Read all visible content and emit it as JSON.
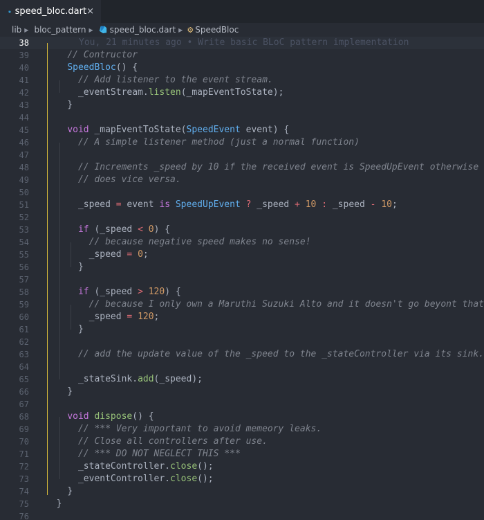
{
  "tab": {
    "label": "speed_bloc.dart",
    "close": "×"
  },
  "breadcrumb": [
    "lib",
    "bloc_pattern",
    "speed_bloc.dart",
    "SpeedBloc"
  ],
  "colors": {
    "accent": "#d7ba3a",
    "editor_bg": "#282c34",
    "tab_bg": "#21252b"
  },
  "icons": {
    "tab": "dart-file-icon",
    "breadcrumb_file": "dart-file-icon",
    "breadcrumb_class": "class-icon"
  },
  "current_line": 38,
  "blame": "You, 21 minutes ago • Write basic BLoC pattern implementation",
  "lines": [
    {
      "num": 38,
      "html": ""
    },
    {
      "num": 39,
      "html": "    <span class=\"c\">// Contructor</span>"
    },
    {
      "num": 40,
      "html": "    <span class=\"t\">SpeedBloc</span>() {"
    },
    {
      "num": 41,
      "html": "      <span class=\"c\">// Add listener to the event stream.</span>"
    },
    {
      "num": 42,
      "html": "      _eventStream.<span class=\"f\">listen</span>(_mapEventToState);"
    },
    {
      "num": 43,
      "html": "    }"
    },
    {
      "num": 44,
      "html": ""
    },
    {
      "num": 45,
      "html": "    <span class=\"k\">void</span> _mapEventToState(<span class=\"t\">SpeedEvent</span> event) {"
    },
    {
      "num": 46,
      "html": "      <span class=\"c\">// A simple listener method (just a normal function)</span>"
    },
    {
      "num": 47,
      "html": ""
    },
    {
      "num": 48,
      "html": "      <span class=\"c\">// Increments _speed by 10 if the received event is SpeedUpEvent otherwise</span>"
    },
    {
      "num": 49,
      "html": "      <span class=\"c\">// does vice versa.</span>"
    },
    {
      "num": 50,
      "html": ""
    },
    {
      "num": 51,
      "html": "      _speed <span class=\"o\">=</span> event <span class=\"k\">is</span> <span class=\"t\">SpeedUpEvent</span> <span class=\"o\">?</span> _speed <span class=\"o\">+</span> <span class=\"n\">10</span> <span class=\"o\">:</span> _speed <span class=\"o\">-</span> <span class=\"n\">10</span>;"
    },
    {
      "num": 52,
      "html": ""
    },
    {
      "num": 53,
      "html": "      <span class=\"k\">if</span> (_speed <span class=\"o\">&lt;</span> <span class=\"n\">0</span>) {"
    },
    {
      "num": 54,
      "html": "        <span class=\"c\">// because negative speed makes no sense!</span>"
    },
    {
      "num": 55,
      "html": "        _speed <span class=\"o\">=</span> <span class=\"n\">0</span>;"
    },
    {
      "num": 56,
      "html": "      }"
    },
    {
      "num": 57,
      "html": ""
    },
    {
      "num": 58,
      "html": "      <span class=\"k\">if</span> (_speed <span class=\"o\">&gt;</span> <span class=\"n\">120</span>) {"
    },
    {
      "num": 59,
      "html": "        <span class=\"c\">// because I only own a Maruthi Suzuki Alto and it doesn't go beyont that.</span>"
    },
    {
      "num": 60,
      "html": "        _speed <span class=\"o\">=</span> <span class=\"n\">120</span>;"
    },
    {
      "num": 61,
      "html": "      }"
    },
    {
      "num": 62,
      "html": ""
    },
    {
      "num": 63,
      "html": "      <span class=\"c\">// add the update value of the _speed to the _stateController via its sink.</span>"
    },
    {
      "num": 64,
      "html": ""
    },
    {
      "num": 65,
      "html": "      _stateSink.<span class=\"f\">add</span>(_speed);"
    },
    {
      "num": 66,
      "html": "    }"
    },
    {
      "num": 67,
      "html": ""
    },
    {
      "num": 68,
      "html": "    <span class=\"k\">void</span> <span class=\"f\">dispose</span>() {"
    },
    {
      "num": 69,
      "html": "      <span class=\"c\">// *** Very important to avoid memeory leaks.</span>"
    },
    {
      "num": 70,
      "html": "      <span class=\"c\">// Close all controllers after use.</span>"
    },
    {
      "num": 71,
      "html": "      <span class=\"c\">// *** DO NOT NEGLECT THIS ***</span>"
    },
    {
      "num": 72,
      "html": "      _stateController.<span class=\"f\">close</span>();"
    },
    {
      "num": 73,
      "html": "      _eventController.<span class=\"f\">close</span>();"
    },
    {
      "num": 74,
      "html": "    }"
    },
    {
      "num": 75,
      "html": "  }"
    },
    {
      "num": 76,
      "html": ""
    }
  ]
}
